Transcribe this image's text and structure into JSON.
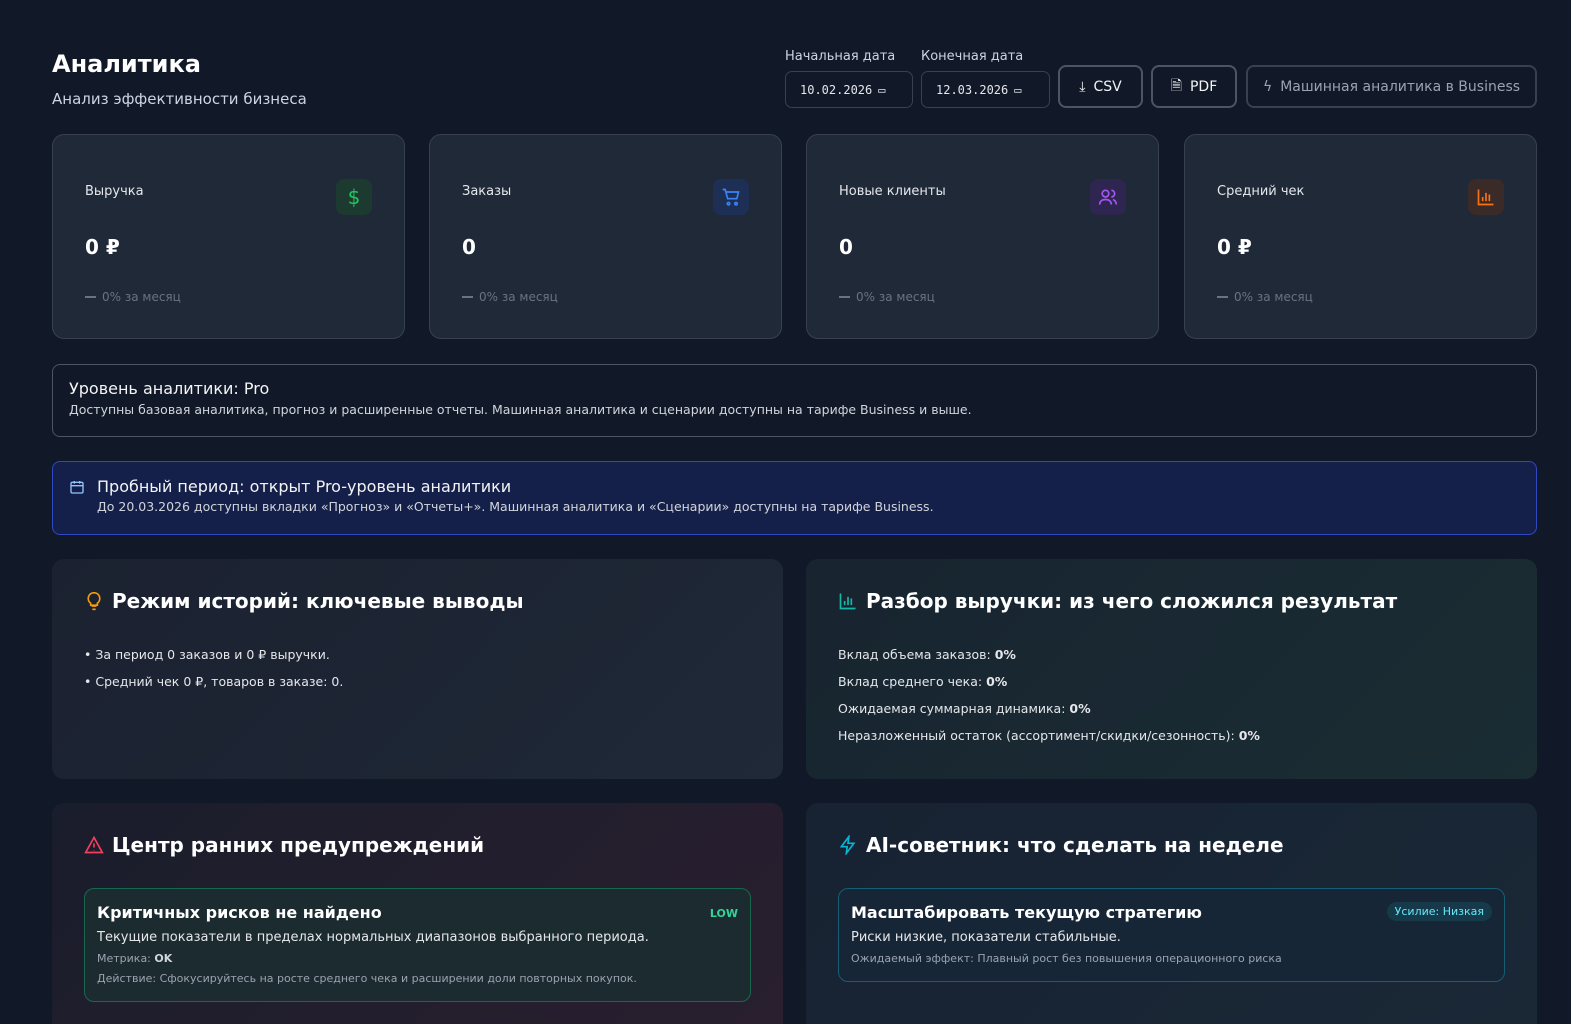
{
  "header": {
    "title": "Аналитика",
    "subtitle": "Анализ эффективности бизнеса"
  },
  "filters": {
    "start_label": "Начальная дата",
    "start_value": "10.02.2026",
    "end_label": "Конечная дата",
    "end_value": "12.03.2026"
  },
  "toolbar": {
    "csv": "CSV",
    "pdf": "PDF",
    "ml": "Машинная аналитика в Business"
  },
  "kpis": [
    {
      "label": "Выручка",
      "value": "0 ₽",
      "change": "0% за месяц",
      "icon": "dollar-icon",
      "color": "#22c55e"
    },
    {
      "label": "Заказы",
      "value": "0",
      "change": "0% за месяц",
      "icon": "cart-icon",
      "color": "#3b82f6"
    },
    {
      "label": "Новые клиенты",
      "value": "0",
      "change": "0% за месяц",
      "icon": "users-icon",
      "color": "#a855f7"
    },
    {
      "label": "Средний чек",
      "value": "0 ₽",
      "change": "0% за месяц",
      "icon": "bar-chart-icon",
      "color": "#f97316"
    }
  ],
  "level": {
    "title": "Уровень аналитики: Pro",
    "text": "Доступны базовая аналитика, прогноз и расширенные отчеты. Машинная аналитика и сценарии доступны на тарифе Business и выше."
  },
  "trial": {
    "title": "Пробный период: открыт Pro-уровень аналитики",
    "text": "До 20.03.2026 доступны вкладки «Прогноз» и «Отчеты+». Машинная аналитика и «Сценарии» доступны на тарифе Business."
  },
  "stories": {
    "title": "Режим историй: ключевые выводы",
    "items": [
      "• За период 0 заказов и 0 ₽ выручки.",
      "• Средний чек 0 ₽, товаров в заказе: 0."
    ]
  },
  "revenue": {
    "title": "Разбор выручки: из чего сложился результат",
    "items": [
      {
        "label": "Вклад объема заказов: ",
        "value": "0%"
      },
      {
        "label": "Вклад среднего чека: ",
        "value": "0%"
      },
      {
        "label": "Ожидаемая суммарная динамика: ",
        "value": "0%"
      },
      {
        "label": "Неразложенный остаток (ассортимент/скидки/сезонность): ",
        "value": "0%"
      }
    ]
  },
  "warnings": {
    "title": "Центр ранних предупреждений",
    "card": {
      "title": "Критичных рисков не найдено",
      "badge": "LOW",
      "text": "Текущие показатели в пределах нормальных диапазонов выбранного периода.",
      "metric_label": "Метрика: ",
      "metric_value": "OK",
      "action": "Действие: Сфокусируйтесь на росте среднего чека и расширении доли повторных покупок."
    }
  },
  "advisor": {
    "title": "AI-советник: что сделать на неделе",
    "card": {
      "title": "Масштабировать текущую стратегию",
      "badge": "Усилие: Низкая",
      "text": "Риски низкие, показатели стабильные.",
      "effect": "Ожидаемый эффект: Плавный рост без повышения операционного риска"
    }
  }
}
